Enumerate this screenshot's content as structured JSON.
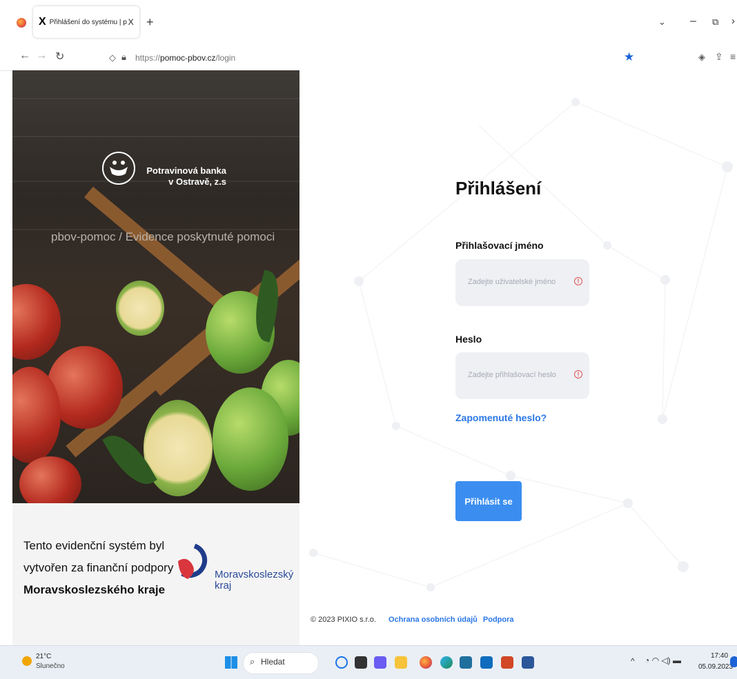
{
  "browser": {
    "tab_title": "Přihlášení do systému | pbov-p",
    "tab_close": "X",
    "new_tab": "+",
    "url_prefix": "https://",
    "url_domain": "pomoc-pbov.cz",
    "url_path": "/login"
  },
  "left": {
    "brand_line1": "Potravinová banka",
    "brand_line2": "v Ostravě, z.s",
    "subtitle": "pbov-pomoc / Evidence poskytnuté pomoci",
    "sponsor_line1": "Tento evidenční systém byl",
    "sponsor_line2": "vytvořen za finanční podpory",
    "sponsor_line3": "Moravskoslezského kraje",
    "msk_name1": "Moravskoslezský",
    "msk_name2": "kraj"
  },
  "login": {
    "title": "Přihlášení",
    "username_label": "Přihlašovací jméno",
    "username_placeholder": "Zadejte uživatelské jméno",
    "password_label": "Heslo",
    "password_placeholder": "Zadejte přihlašovací heslo",
    "forgot": "Zapomenuté heslo?",
    "submit": "Přihlásit se"
  },
  "footer": {
    "copyright": "© 2023 PIXIO s.r.o.",
    "privacy": "Ochrana osobních údajů",
    "support": "Podpora"
  },
  "taskbar": {
    "temp": "21°C",
    "weather": "Slunečno",
    "search": "Hledat",
    "time": "17:40",
    "date": "05.09.2023"
  }
}
